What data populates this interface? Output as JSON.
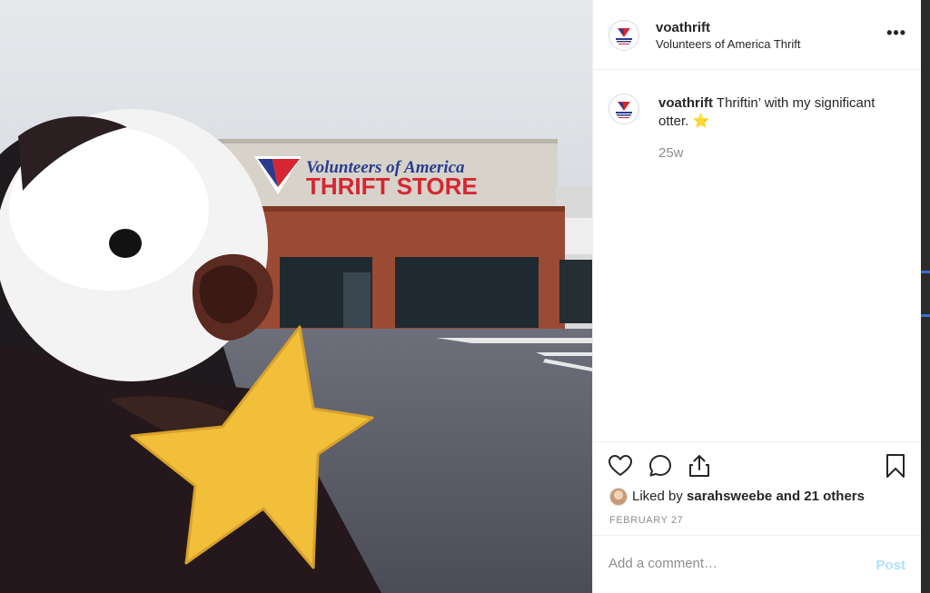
{
  "photo": {
    "store_sign_line1": "Volunteers of America",
    "store_sign_line2": "THRIFT STORE"
  },
  "post": {
    "username": "voathrift",
    "subtitle": "Volunteers of America Thrift",
    "more_icon": "more-horizontal-icon",
    "caption_user": "voathrift",
    "caption_text": "Thriftin’ with my significant otter.",
    "caption_emoji": "⭐",
    "age": "25w"
  },
  "actions": {
    "icons": [
      "heart-icon",
      "comment-icon",
      "share-icon",
      "bookmark-icon"
    ],
    "liked_by_prefix": "Liked by ",
    "liked_by_user": "sarahsweebe",
    "liked_by_suffix": " and 21 others",
    "date": "FEBRUARY 27"
  },
  "comment": {
    "placeholder": "Add a comment…",
    "post_label": "Post"
  },
  "colors": {
    "text": "#262626",
    "secondary": "#8e8e8e",
    "post_button_disabled": "#b2dffc",
    "border": "#efefef"
  }
}
